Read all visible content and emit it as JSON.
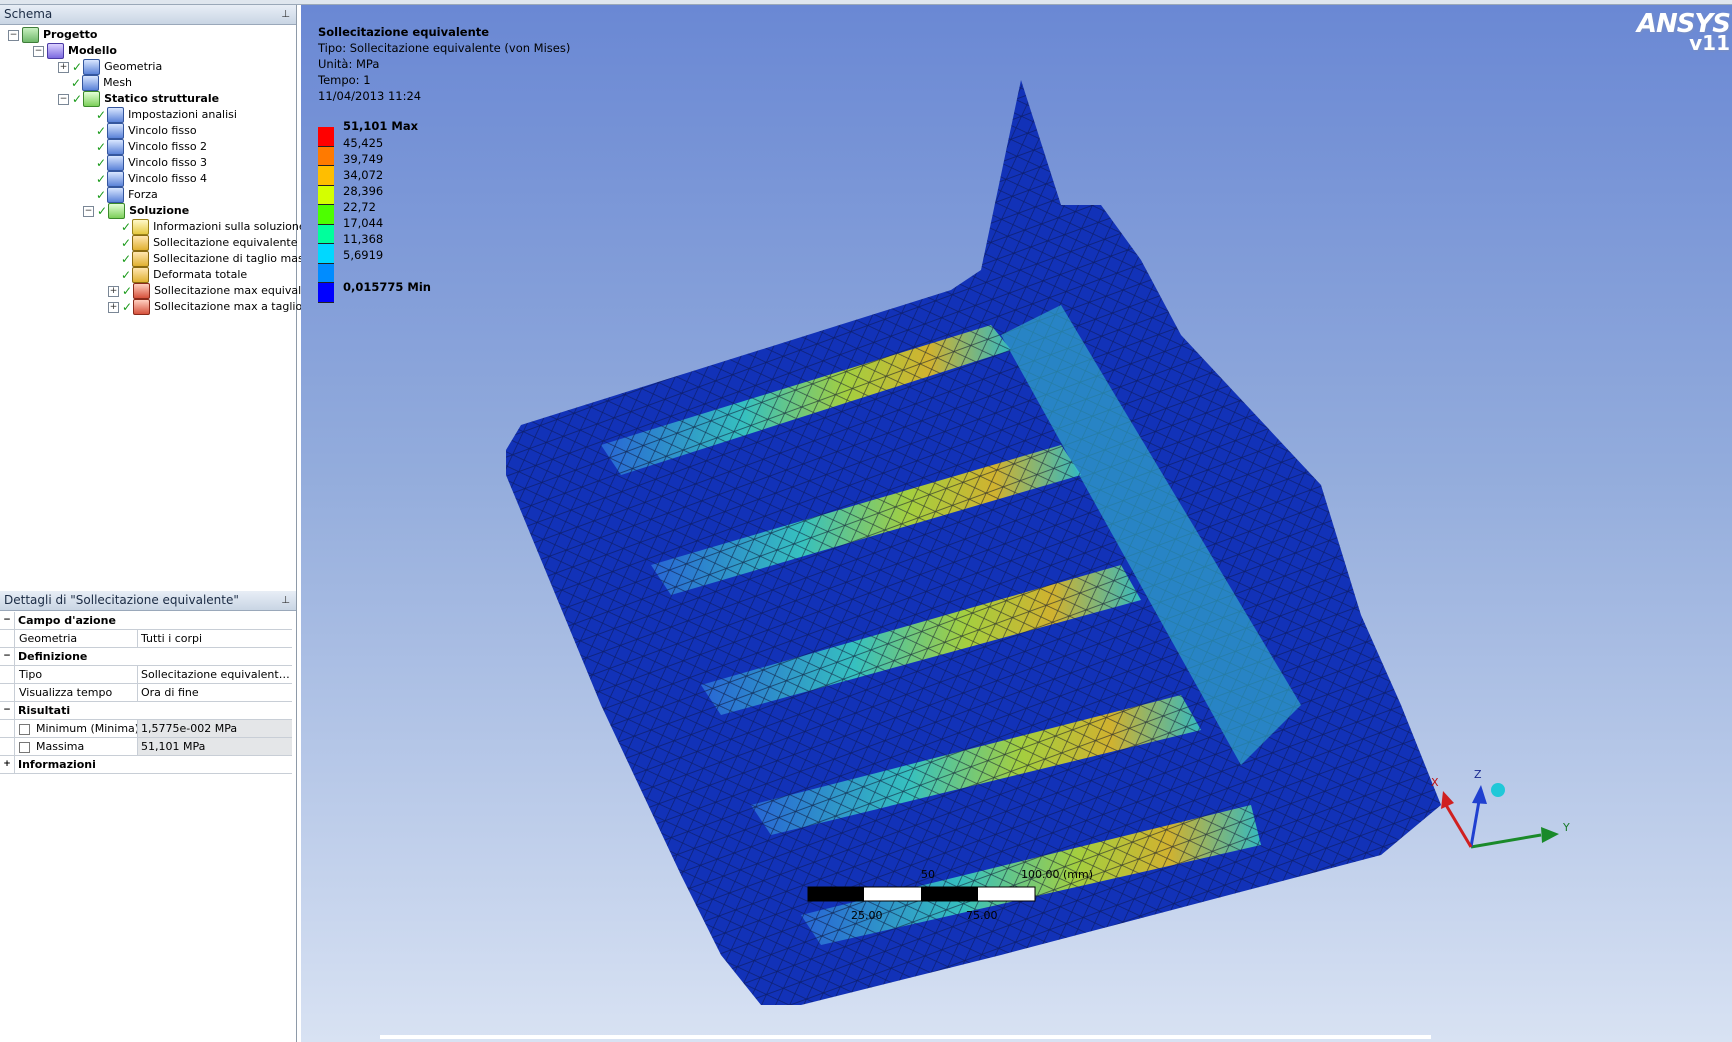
{
  "outline": {
    "title": "Schema",
    "tree": [
      {
        "label": "Progetto",
        "level": 0,
        "bold": true,
        "icon": "project-icon"
      },
      {
        "label": "Modello",
        "level": 1,
        "bold": true,
        "icon": "model-icon"
      },
      {
        "label": "Geometria",
        "level": 2,
        "icon": "geometry-icon"
      },
      {
        "label": "Mesh",
        "level": 2,
        "icon": "mesh-icon"
      },
      {
        "label": "Statico strutturale",
        "level": 2,
        "bold": true,
        "icon": "static-structural-icon"
      },
      {
        "label": "Impostazioni analisi",
        "level": 3,
        "icon": "analysis-settings-icon"
      },
      {
        "label": "Vincolo fisso",
        "level": 3,
        "icon": "fixed-support-icon"
      },
      {
        "label": "Vincolo fisso 2",
        "level": 3,
        "icon": "fixed-support-icon"
      },
      {
        "label": "Vincolo fisso 3",
        "level": 3,
        "icon": "fixed-support-icon"
      },
      {
        "label": "Vincolo fisso 4",
        "level": 3,
        "icon": "fixed-support-icon"
      },
      {
        "label": "Forza",
        "level": 3,
        "icon": "force-icon"
      },
      {
        "label": "Soluzione",
        "level": 3,
        "bold": true,
        "icon": "solution-icon"
      },
      {
        "label": "Informazioni sulla soluzione",
        "level": 4,
        "icon": "solution-info-icon"
      },
      {
        "label": "Sollecitazione equivalente",
        "level": 4,
        "icon": "result-icon"
      },
      {
        "label": "Sollecitazione di taglio massima",
        "level": 4,
        "icon": "result-icon"
      },
      {
        "label": "Deformata totale",
        "level": 4,
        "icon": "result-icon"
      },
      {
        "label": "Sollecitazione max equivalente",
        "level": 4,
        "icon": "stress-tool-icon"
      },
      {
        "label": "Sollecitazione max a taglio",
        "level": 4,
        "icon": "stress-tool-icon"
      }
    ]
  },
  "details": {
    "title": "Dettagli di \"Sollecitazione equivalente\"",
    "rows": [
      {
        "type": "cat",
        "label": "Campo d'azione",
        "toggle": "−"
      },
      {
        "type": "prop",
        "key": "Geometria",
        "value": "Tutti i corpi"
      },
      {
        "type": "cat",
        "label": "Definizione",
        "toggle": "−"
      },
      {
        "type": "prop",
        "key": "Tipo",
        "value": "Sollecitazione equivalente (v..."
      },
      {
        "type": "prop",
        "key": "Visualizza tempo",
        "value": "Ora di fine"
      },
      {
        "type": "cat",
        "label": "Risultati",
        "toggle": "−"
      },
      {
        "type": "res",
        "key": "Minimum (Minima)",
        "value": "1,5775e-002 MPa"
      },
      {
        "type": "res",
        "key": "Massima",
        "value": "51,101 MPa"
      },
      {
        "type": "cat",
        "label": "Informazioni",
        "toggle": "+"
      }
    ]
  },
  "viewport": {
    "result_title": "Sollecitazione equivalente",
    "type_line": "Tipo: Sollecitazione equivalente (von Mises)",
    "unit_line": "Unità: MPa",
    "time_line": "Tempo: 1",
    "date_line": "11/04/2013 11:24",
    "legend": {
      "max_label": "51,101 Max",
      "min_label": "0,015775 Min",
      "values": [
        "45,425",
        "39,749",
        "34,072",
        "28,396",
        "22,72",
        "17,044",
        "11,368",
        "5,6919"
      ],
      "colors": [
        "#ff0000",
        "#ff7a00",
        "#ffbe00",
        "#d4ff00",
        "#4dff00",
        "#00ff9c",
        "#00d8ff",
        "#008cff",
        "#0000ff"
      ]
    },
    "logo": {
      "name": "ANSYS",
      "version": "v11"
    },
    "scale": {
      "label_top": "100.00 (mm)",
      "label_mid_hidden": "50",
      "label_a": "25.00",
      "label_b": "75.00"
    },
    "triad": {
      "x": "X",
      "y": "Y",
      "z": "Z"
    }
  }
}
